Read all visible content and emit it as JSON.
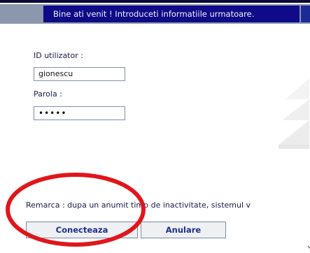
{
  "header": {
    "welcome_text": "Bine ati venit ! Introduceti informatiile urmatoare."
  },
  "login_form": {
    "user_id_label": "ID utilizator :",
    "user_id_value": "gionescu",
    "password_label": "Parola :",
    "password_value": "•••••"
  },
  "note": {
    "text": "Remarca : dupa un anumit timp de inactivitate, sistemul v"
  },
  "buttons": {
    "connect_label": "Conecteaza",
    "cancel_label": "Anulare"
  },
  "colors": {
    "header_bar": "#0e0a88",
    "header_frame": "#8c96ac",
    "annotation_ellipse": "#e0161b"
  }
}
